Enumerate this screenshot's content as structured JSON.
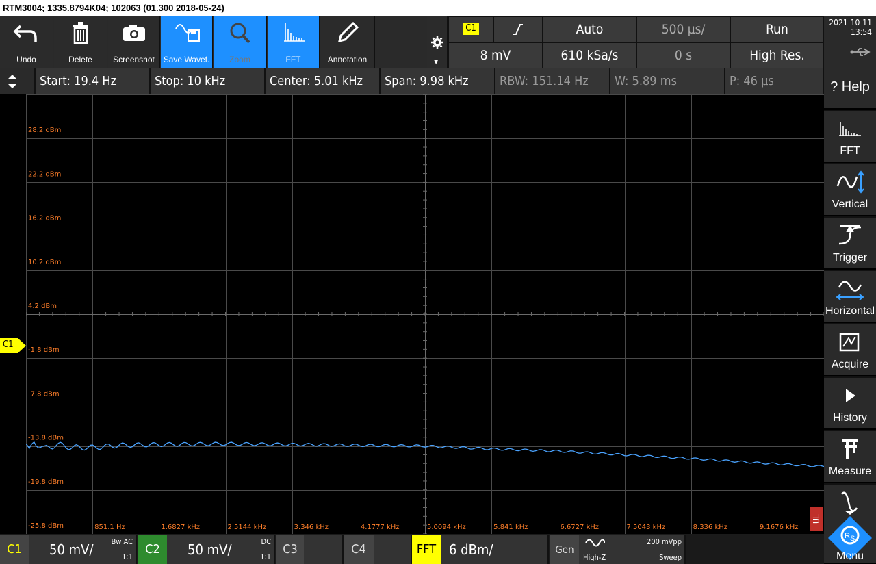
{
  "title": "RTM3004; 1335.8794K04; 102063 (01.300 2018-05-24)",
  "toolbar": {
    "undo": "Undo",
    "delete": "Delete",
    "screenshot": "Screenshot",
    "save_waveform": "Save Wavef.",
    "zoom": "Zoom",
    "fft": "FFT",
    "annotation": "Annotation"
  },
  "trigger": {
    "source": "C1",
    "mode": "Auto",
    "level": "8 mV"
  },
  "timebase": {
    "scale": "500 µs/",
    "sample_rate": "610 kSa/s",
    "position": "0 s"
  },
  "acquisition": {
    "state": "Run",
    "mode": "High Res."
  },
  "clock": {
    "date": "2021-10-11",
    "time": "13:54"
  },
  "fft_info": {
    "start": "Start: 19.4 Hz",
    "stop": "Stop: 10 kHz",
    "center": "Center: 5.01 kHz",
    "span": "Span: 9.98 kHz",
    "rbw": "RBW: 151.14 Hz",
    "window": "W: 5.89 ms",
    "points": "P: 46 µs"
  },
  "right_panel": {
    "help": "Help",
    "fft": "FFT",
    "vertical": "Vertical",
    "trigger": "Trigger",
    "horizontal": "Horizontal",
    "acquire": "Acquire",
    "history": "History",
    "measure": "Measure",
    "menu": "Menu"
  },
  "channel_marker": "C1",
  "ul_marker": "UL",
  "bottom": {
    "c1": {
      "label": "C1",
      "scale": "50 mV/",
      "bw": "Bw AC",
      "ratio": "1:1"
    },
    "c2": {
      "label": "C2",
      "scale": "50 mV/",
      "coupling": "DC",
      "ratio": "1:1"
    },
    "c3": {
      "label": "C3"
    },
    "c4": {
      "label": "C4"
    },
    "fft": {
      "label": "FFT",
      "scale": "6 dBm/"
    },
    "gen": {
      "label": "Gen",
      "mode": "High-Z",
      "amplitude": "200 mVpp",
      "function": "Sweep"
    }
  },
  "colors": {
    "accent": "#1e90ff",
    "c1": "#ffff00",
    "c2": "#2e8b2e",
    "trace": "#4aa3ff",
    "labels": "#ff7f2a"
  },
  "chart_data": {
    "type": "line",
    "y_tick_labels": [
      "28.2 dBm",
      "22.2 dBm",
      "16.2 dBm",
      "10.2 dBm",
      "4.2 dBm",
      "-1.8 dBm",
      "-7.8 dBm",
      "-13.8 dBm",
      "-19.8 dBm",
      "-25.8 dBm"
    ],
    "x_tick_labels": [
      "851.1 Hz",
      "1.6827 kHz",
      "2.5144 kHz",
      "3.346 kHz",
      "4.1777 kHz",
      "5.0094 kHz",
      "5.841 kHz",
      "6.6727 kHz",
      "7.5043 kHz",
      "8.336 kHz",
      "9.1676 kHz"
    ],
    "xlim_hz": [
      19.4,
      10000
    ],
    "ylim_dbm": [
      -25.8,
      34.2
    ],
    "series": [
      {
        "color": "#4aa3ff",
        "x_hz": [
          19.4,
          60,
          120,
          250,
          400,
          600,
          851,
          1200,
          1683,
          2514,
          3346,
          4178,
          5009,
          5841,
          6673,
          7504,
          8336,
          9168,
          10000
        ],
        "y_dbm": [
          -13.5,
          -14.6,
          -13.2,
          -14.2,
          -13.6,
          -14.0,
          -14.0,
          -13.7,
          -13.6,
          -13.5,
          -13.6,
          -13.7,
          -13.8,
          -14.2,
          -14.5,
          -15.0,
          -15.5,
          -16.1,
          -16.6
        ]
      }
    ]
  }
}
